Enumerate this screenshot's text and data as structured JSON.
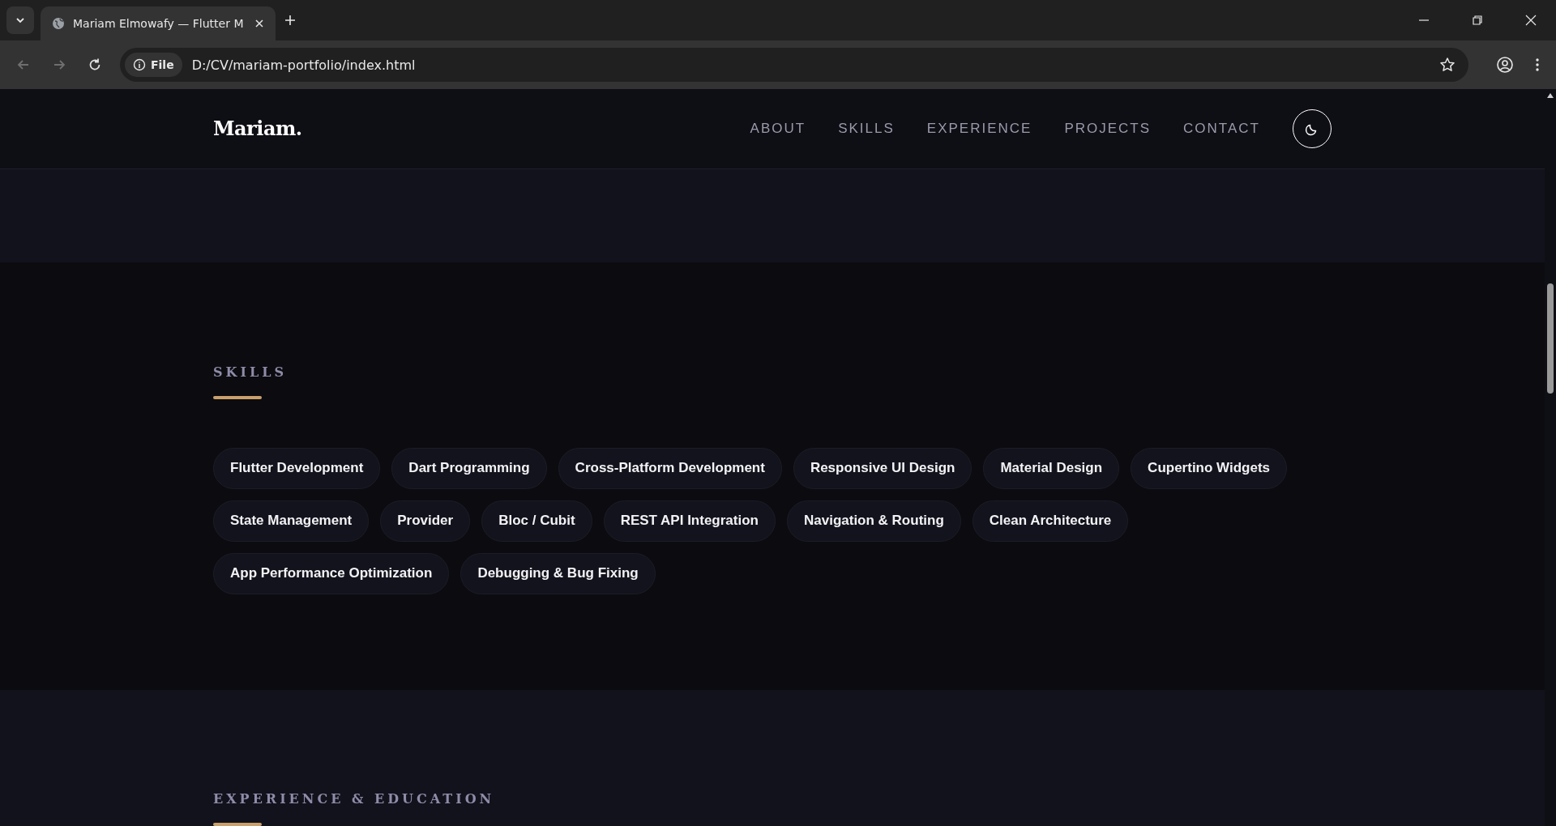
{
  "browser": {
    "tab_title": "Mariam Elmowafy — Flutter M",
    "address": "D:/CV/mariam-portfolio/index.html",
    "scheme_label": "File"
  },
  "nav": {
    "logo": "Mariam.",
    "links": [
      {
        "label": "ABOUT"
      },
      {
        "label": "SKILLS"
      },
      {
        "label": "EXPERIENCE"
      },
      {
        "label": "PROJECTS"
      },
      {
        "label": "CONTACT"
      }
    ]
  },
  "skills": {
    "heading": "SKILLS",
    "chips": [
      "Flutter Development",
      "Dart Programming",
      "Cross-Platform Development",
      "Responsive UI Design",
      "Material Design",
      "Cupertino Widgets",
      "State Management",
      "Provider",
      "Bloc / Cubit",
      "REST API Integration",
      "Navigation & Routing",
      "Clean Architecture",
      "App Performance Optimization",
      "Debugging & Bug Fixing"
    ]
  },
  "experience": {
    "heading": "EXPERIENCE & EDUCATION"
  }
}
